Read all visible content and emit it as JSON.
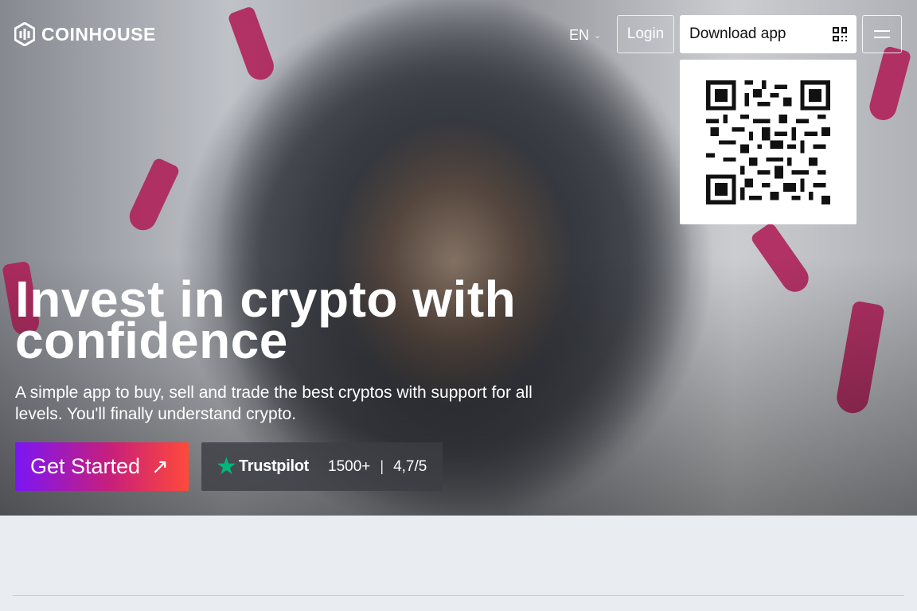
{
  "header": {
    "logo_text": "COINHOUSE",
    "language": "EN",
    "login_label": "Login",
    "download_label": "Download app"
  },
  "hero": {
    "headline_line1": "Invest in crypto with",
    "headline_line2": "confidence",
    "subheadline": "A simple app to buy, sell and trade the best cryptos with support for all levels. You'll finally understand crypto.",
    "cta_label": "Get Started",
    "trustpilot": {
      "brand": "Trustpilot",
      "reviews": "1500+",
      "separator": "|",
      "rating": "4,7/5"
    }
  },
  "icons": {
    "logo": "coinhouse-logo-icon",
    "language_dropdown": "chevron-down-icon",
    "download": "qr-code-icon",
    "menu": "hamburger-menu-icon",
    "cta": "arrow-up-right-icon",
    "trustpilot": "star-icon"
  },
  "colors": {
    "cta_gradient_start": "#7b16f5",
    "cta_gradient_mid": "#c81f7a",
    "cta_gradient_end": "#ff4a3a",
    "trustpilot_green": "#00b67a",
    "page_background": "#e9ecf0"
  }
}
